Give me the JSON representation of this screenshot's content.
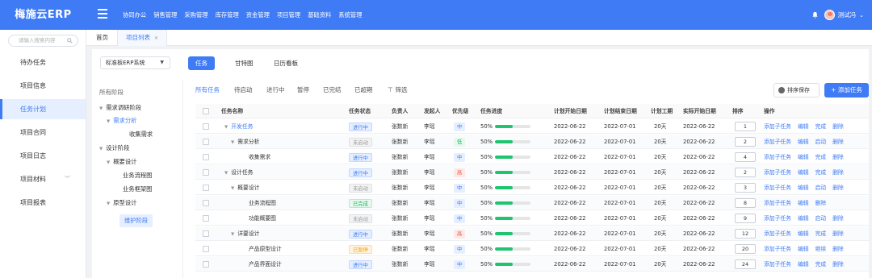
{
  "brand": "梅施云ERP",
  "topnav": [
    "协同办公",
    "销售管理",
    "采购管理",
    "库存管理",
    "资金管理",
    "项目管理",
    "基础资料",
    "系统管理"
  ],
  "user": {
    "name": "测试冯"
  },
  "sidebar": {
    "search_placeholder": "请输入搜索内容",
    "items": [
      {
        "label": "待办任务"
      },
      {
        "label": "项目信息"
      },
      {
        "label": "任务计划",
        "active": true
      },
      {
        "label": "项目合同"
      },
      {
        "label": "项目日志"
      },
      {
        "label": "项目材料"
      },
      {
        "label": "项目报表"
      }
    ]
  },
  "page_tabs": [
    {
      "label": "首页"
    },
    {
      "label": "项目列表",
      "active": true
    }
  ],
  "system_select": "标准板ERP系统",
  "view_tabs": [
    {
      "label": "任务",
      "active": true
    },
    {
      "label": "甘特图"
    },
    {
      "label": "日历看板"
    }
  ],
  "tree": {
    "title": "所有阶段",
    "nodes": [
      {
        "label": "需求调研阶段"
      },
      {
        "label": "需求分析"
      },
      {
        "label": "收集需求"
      },
      {
        "label": "设计阶段"
      },
      {
        "label": "概要设计"
      },
      {
        "label": "业务流程图"
      },
      {
        "label": "业务框架图"
      },
      {
        "label": "原型设计"
      },
      {
        "label": "维护阶段"
      }
    ]
  },
  "filters": [
    "所有任务",
    "待启动",
    "进行中",
    "暂停",
    "已完结",
    "已超期",
    "筛选"
  ],
  "buttons": {
    "save_order": "排序保存",
    "add_task": "+ 添加任务"
  },
  "columns": [
    "任务名称",
    "任务状态",
    "负责人",
    "发起人",
    "优先级",
    "任务进度",
    "计划开始日期",
    "计划结束日期",
    "计划工期",
    "实际开始日期",
    "排序",
    "操作"
  ],
  "rows": [
    {
      "name": "开发任务",
      "status": "进行中",
      "owner": "张数新",
      "initiator": "李瑶",
      "priority": "中",
      "progress": "50%",
      "progress_value": 50,
      "plan_start": "2022-06-22",
      "plan_end": "2022-07-01",
      "duration": "20天",
      "actual_start": "2022-06-22",
      "order": "1",
      "actions": [
        "添加子任务",
        "编辑",
        "完成",
        "删除"
      ]
    },
    {
      "name": "需求分析",
      "status": "未启动",
      "owner": "张数新",
      "initiator": "李瑶",
      "priority": "低",
      "progress": "50%",
      "progress_value": 50,
      "plan_start": "2022-06-22",
      "plan_end": "2022-07-01",
      "duration": "20天",
      "actual_start": "2022-06-22",
      "order": "2",
      "actions": [
        "添加子任务",
        "编辑",
        "启动",
        "删除"
      ]
    },
    {
      "name": "收集需求",
      "status": "进行中",
      "owner": "张数新",
      "initiator": "李瑶",
      "priority": "中",
      "progress": "50%",
      "progress_value": 50,
      "plan_start": "2022-06-22",
      "plan_end": "2022-07-01",
      "duration": "20天",
      "actual_start": "2022-06-22",
      "order": "4",
      "actions": [
        "添加子任务",
        "编辑",
        "完成",
        "删除"
      ]
    },
    {
      "name": "设计任务",
      "status": "进行中",
      "owner": "张数新",
      "initiator": "李瑶",
      "priority": "高",
      "progress": "50%",
      "progress_value": 50,
      "plan_start": "2022-06-22",
      "plan_end": "2022-07-01",
      "duration": "20天",
      "actual_start": "2022-06-22",
      "order": "2",
      "actions": [
        "添加子任务",
        "编辑",
        "完成",
        "删除"
      ]
    },
    {
      "name": "概要设计",
      "status": "未启动",
      "owner": "张数新",
      "initiator": "李瑶",
      "priority": "中",
      "progress": "50%",
      "progress_value": 50,
      "plan_start": "2022-06-22",
      "plan_end": "2022-07-01",
      "duration": "20天",
      "actual_start": "2022-06-22",
      "order": "3",
      "actions": [
        "添加子任务",
        "编辑",
        "启动",
        "删除"
      ]
    },
    {
      "name": "业务流程图",
      "status": "已完成",
      "owner": "张数新",
      "initiator": "李瑶",
      "priority": "中",
      "progress": "50%",
      "progress_value": 50,
      "plan_start": "2022-06-22",
      "plan_end": "2022-07-01",
      "duration": "20天",
      "actual_start": "2022-06-22",
      "order": "8",
      "actions": [
        "添加子任务",
        "编辑",
        "删除"
      ]
    },
    {
      "name": "功能概要图",
      "status": "未启动",
      "owner": "张数新",
      "initiator": "李瑶",
      "priority": "中",
      "progress": "50%",
      "progress_value": 50,
      "plan_start": "2022-06-22",
      "plan_end": "2022-07-01",
      "duration": "20天",
      "actual_start": "2022-06-22",
      "order": "9",
      "actions": [
        "添加子任务",
        "编辑",
        "启动",
        "删除"
      ]
    },
    {
      "name": "详要设计",
      "status": "进行中",
      "owner": "张数新",
      "initiator": "李瑶",
      "priority": "高",
      "progress": "50%",
      "progress_value": 50,
      "plan_start": "2022-06-22",
      "plan_end": "2022-07-01",
      "duration": "20天",
      "actual_start": "2022-06-22",
      "order": "12",
      "actions": [
        "添加子任务",
        "编辑",
        "完成",
        "删除"
      ]
    },
    {
      "name": "产品原型设计",
      "status": "已暂停",
      "owner": "张数新",
      "initiator": "李瑶",
      "priority": "中",
      "progress": "50%",
      "progress_value": 50,
      "plan_start": "2022-06-22",
      "plan_end": "2022-07-01",
      "duration": "20天",
      "actual_start": "2022-06-22",
      "order": "20",
      "actions": [
        "添加子任务",
        "编辑",
        "继续",
        "删除"
      ]
    },
    {
      "name": "产品界面设计",
      "status": "进行中",
      "owner": "张数新",
      "initiator": "李瑶",
      "priority": "中",
      "progress": "50%",
      "progress_value": 50,
      "plan_start": "2022-06-22",
      "plan_end": "2022-07-01",
      "duration": "20天",
      "actual_start": "2022-06-22",
      "order": "24",
      "actions": [
        "添加子任务",
        "编辑",
        "完成",
        "删除"
      ]
    }
  ],
  "colors": {
    "accent": "#3f7bf5",
    "progress": "#1fc46f"
  }
}
